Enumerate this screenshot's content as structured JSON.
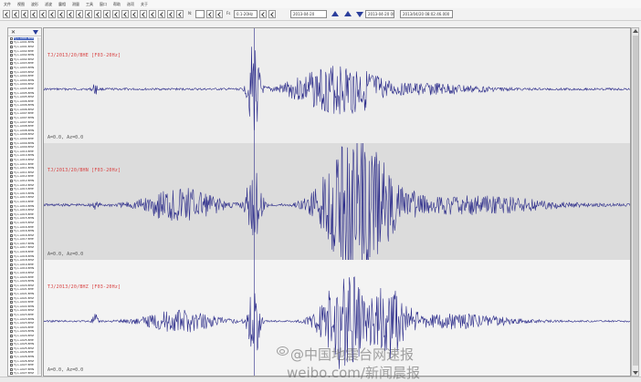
{
  "menu": [
    "文件",
    "视图",
    "波形",
    "滤波",
    "震相",
    "测量",
    "工具",
    "窗口",
    "帮助",
    "选项",
    "关于"
  ],
  "toolbar": {
    "field_label_1": "N:",
    "field_label_2": "Fs",
    "time_field": "2013-04-20 08:02:46",
    "scale_field": "0.1-20Hz",
    "date_field": "2013-04-20",
    "wide_field": "2013/04/20 08:02:46.000"
  },
  "sidebar": {
    "items": [
      "T.J.L.A001.BHE",
      "T.J.L.A001.BHN",
      "T.J.L.A001.BHZ",
      "T.J.L.A002.BHE",
      "T.J.L.A002.BHN",
      "T.J.L.A002.BHZ",
      "T.J.L.A003.BHE",
      "T.J.L.A003.BHN",
      "T.J.L.A003.BHZ",
      "T.J.L.A004.BHE",
      "T.J.L.A004.BHN",
      "T.J.L.A004.BHZ",
      "T.J.L.A005.BHE",
      "T.J.L.A005.BHN",
      "T.J.L.A005.BHZ",
      "T.J.L.A006.BHE",
      "T.J.L.A006.BHN",
      "T.J.L.A006.BHZ",
      "T.J.L.A007.BHE",
      "T.J.L.A007.BHN",
      "T.J.L.A007.BHZ",
      "T.J.L.A008.BHE",
      "T.J.L.A008.BHN",
      "T.J.L.A008.BHZ",
      "T.J.L.A009.BHE",
      "T.J.L.A009.BHN",
      "T.J.L.A009.BHZ",
      "T.J.L.A010.BHE",
      "T.J.L.A010.BHN",
      "T.J.L.A010.BHZ",
      "T.J.L.A011.BHE",
      "T.J.L.A011.BHN",
      "T.J.L.A011.BHZ",
      "T.J.L.A012.BHE",
      "T.J.L.A012.BHN",
      "T.J.L.A012.BHZ",
      "T.J.L.A013.BHE",
      "T.J.L.A013.BHN",
      "T.J.L.A013.BHZ",
      "T.J.L.A014.BHE",
      "T.J.L.A014.BHN",
      "T.J.L.A014.BHZ",
      "T.J.L.A015.BHE",
      "T.J.L.A015.BHN",
      "T.J.L.A015.BHZ",
      "T.J.L.A016.BHE",
      "T.J.L.A016.BHN",
      "T.J.L.A016.BHZ",
      "T.J.L.A017.BHE",
      "T.J.L.A017.BHN",
      "T.J.L.A017.BHZ",
      "T.J.L.A018.BHE",
      "T.J.L.A018.BHN",
      "T.J.L.A018.BHZ",
      "T.J.L.A019.BHE",
      "T.J.L.A019.BHN",
      "T.J.L.A019.BHZ",
      "T.J.L.A020.BHE",
      "T.J.L.A020.BHN",
      "T.J.L.A020.BHZ",
      "T.J.L.A021.BHE",
      "T.J.L.A021.BHN",
      "T.J.L.A021.BHZ",
      "T.J.L.A022.BHE",
      "T.J.L.A022.BHN",
      "T.J.L.A022.BHZ",
      "T.J.L.A023.BHE",
      "T.J.L.A023.BHN",
      "T.J.L.A023.BHZ",
      "T.J.L.A024.BHE",
      "T.J.L.A024.BHN",
      "T.J.L.A024.BHZ",
      "T.J.L.A025.BHE",
      "T.J.L.A025.BHN",
      "T.J.L.A025.BHZ",
      "T.J.L.A026.BHE",
      "T.J.L.A026.BHN",
      "T.J.L.A026.BHZ",
      "T.J.L.A027.BHE",
      "T.J.L.A027.BHN",
      "T.J.L.A027.BHZ"
    ],
    "selected_index": 0
  },
  "channels": [
    {
      "title": "TJ/2013/20/BHE [F03-20Hz]",
      "info": "A=0.0, Az=0.0",
      "color": "#2c2c8a"
    },
    {
      "title": "TJ/2013/20/BHN [F03-20Hz]",
      "info": "A=0.0, Az=0.0",
      "color": "#2c2c8a"
    },
    {
      "title": "TJ/2013/20/BHZ [F03-20Hz]",
      "info": "A=0.0, Az=0.0",
      "color": "#2c2c8a"
    }
  ],
  "watermark": {
    "line1": "@中国地震台网速报",
    "line2": "weibo.com/新闻晨报"
  },
  "colors": {
    "trace": "#2c2c8a",
    "channel_title": "#d84040",
    "toolbar_accent": "#2a3e9c"
  }
}
